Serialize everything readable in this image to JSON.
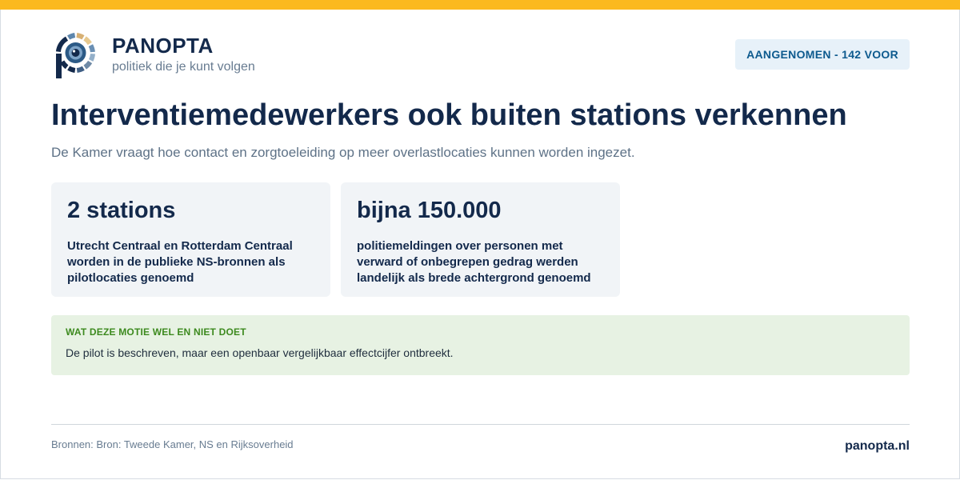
{
  "brand": {
    "name": "PANOPTA",
    "tagline": "politiek die je kunt volgen",
    "logo_icon": "eye-p-logo-icon"
  },
  "status_badge": "AANGENOMEN - 142 VOOR",
  "title": "Interventiemedewerkers ook buiten stations verkennen",
  "subtitle": "De Kamer vraagt hoe contact en zorgtoeleiding op meer overlastlocaties kunnen worden ingezet.",
  "stats": [
    {
      "value": "2 stations",
      "description": "Utrecht Centraal en Rotterdam Centraal worden in de publieke NS-bronnen als pilotlocaties genoemd"
    },
    {
      "value": "bijna 150.000",
      "description": "politiemeldingen over personen met verward of onbegrepen gedrag werden landelijk als brede achtergrond genoemd"
    }
  ],
  "note": {
    "heading": "WAT DEZE MOTIE WEL EN NIET DOET",
    "text": "De pilot is beschreven, maar een openbaar vergelijkbaar effectcijfer ontbreekt."
  },
  "footer": {
    "sources": "Bronnen: Bron: Tweede Kamer, NS en Rijksoverheid",
    "site": "panopta.nl"
  },
  "colors": {
    "accent_bar": "#fbb91e",
    "navy": "#13294b",
    "badge_bg": "#e7f1f9",
    "badge_text": "#0d5a8e",
    "note_bg": "#e7f2e3",
    "note_heading": "#3d8a1f"
  }
}
